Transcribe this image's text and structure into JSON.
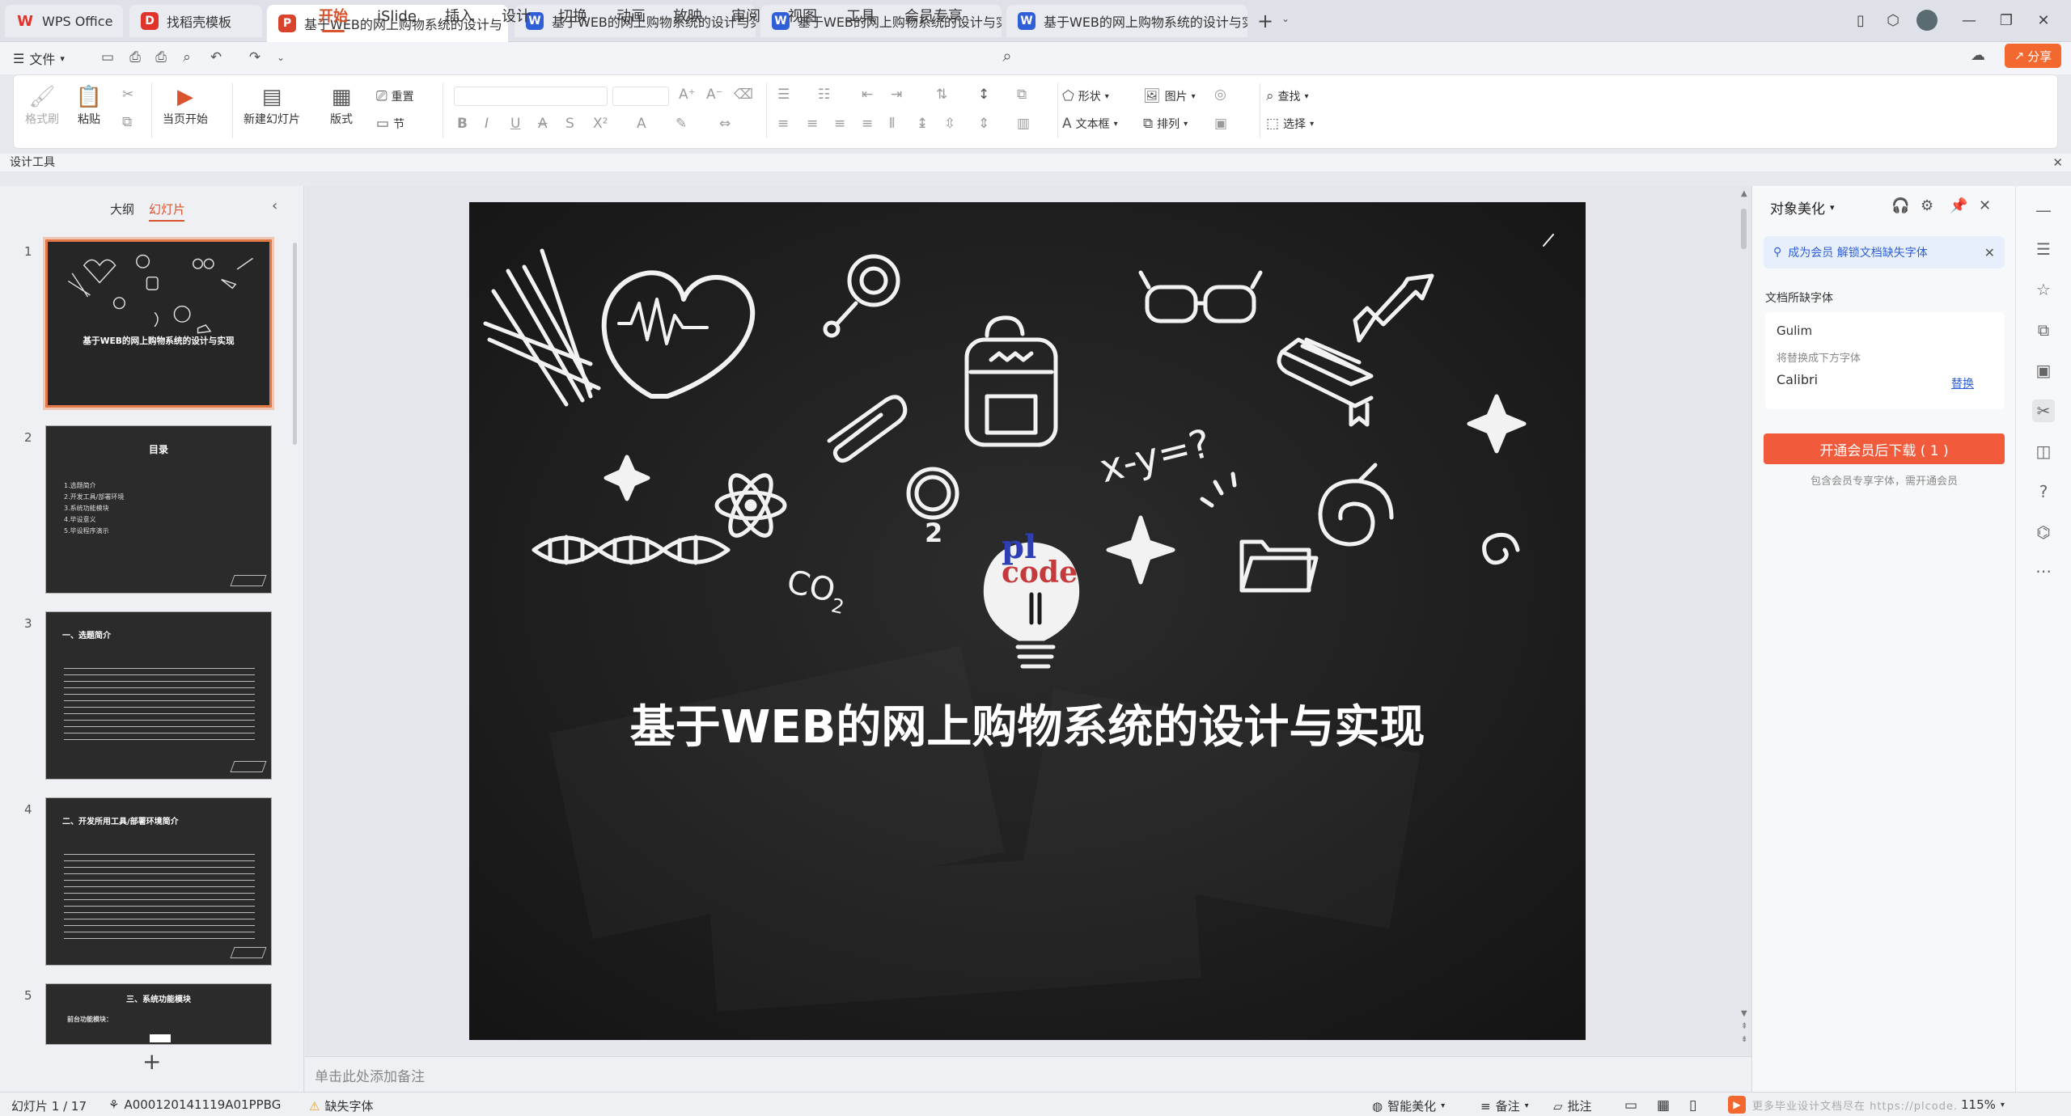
{
  "titlebar": {
    "tabs": [
      {
        "label": "WPS Office",
        "icon": "wps-logo",
        "color": "#e0342b",
        "state": "inactive"
      },
      {
        "label": "找稻壳模板",
        "icon": "docer-icon",
        "color": "#e0342b",
        "state": "inactive"
      },
      {
        "label": "基于WEB的网上购物系统的设计与",
        "icon": "P",
        "color": "#d9432c",
        "state": "active"
      },
      {
        "label": "基于WEB的网上购物系统的设计与实",
        "icon": "W",
        "color": "#2f5fd6",
        "state": "inactive"
      },
      {
        "label": "基于WEB的网上购物系统的设计与实",
        "icon": "W",
        "color": "#2f5fd6",
        "state": "inactive"
      },
      {
        "label": "基于WEB的网上购物系统的设计与实",
        "icon": "W",
        "color": "#2f5fd6",
        "state": "inactive"
      }
    ],
    "new_tab": "+"
  },
  "menubar": {
    "file": "文件",
    "items": [
      "开始",
      "iSlide",
      "插入",
      "设计",
      "切换",
      "动画",
      "放映",
      "审阅",
      "视图",
      "工具",
      "会员专享"
    ],
    "active": "开始",
    "share": "分享"
  },
  "ribbon": {
    "format_painter": "格式刷",
    "paste": "粘贴",
    "play_from_current": "当页开始",
    "new_slide": "新建幻灯片",
    "layout": "版式",
    "reset": "重置",
    "section": "节",
    "shape": "形状",
    "picture": "图片",
    "textbox": "文本框",
    "arrange": "排列",
    "find": "查找",
    "select": "选择"
  },
  "design_tools": "设计工具",
  "left_panel": {
    "tab_outline": "大纲",
    "tab_slides": "幻灯片",
    "add_button": "+",
    "thumbs": [
      {
        "num": "1",
        "title": "基于WEB的网上购物系统的设计与实现"
      },
      {
        "num": "2",
        "title": "目录",
        "lines": [
          "1.选题简介",
          "2.开发工具/部署环境",
          "3.系统功能模块",
          "4.毕设意义",
          "5.毕设程序演示"
        ]
      },
      {
        "num": "3",
        "title": "一、选题简介"
      },
      {
        "num": "4",
        "title": "二、开发所用工具/部署环境简介"
      },
      {
        "num": "5",
        "title": "三、系统功能模块",
        "sub": "前台功能模块："
      }
    ]
  },
  "slide": {
    "title": "基于WEB的网上购物系统的设计与实现",
    "doodle_math": "x-y=?",
    "doodle_co2": "CO",
    "doodle_co2_sub": "2",
    "doodle_two": "2",
    "watermark_top": "pl",
    "watermark_bottom": "code"
  },
  "notes_placeholder": "单击此处添加备注",
  "right_panel": {
    "title": "对象美化",
    "member_tip": "成为会员 解锁文档缺失字体",
    "missing_fonts_label": "文档所缺字体",
    "missing_font": "Gulim",
    "replace_with_label": "将替换成下方字体",
    "replacement_font": "Calibri",
    "replace_link": "替换",
    "download_button": "开通会员后下载 ( 1 )",
    "download_note": "包含会员专享字体，需开通会员",
    "accent": "#f15a3a"
  },
  "statusbar": {
    "slide_counter": "幻灯片 1 / 17",
    "template_id": "A000120141119A01PPBG",
    "missing_font": "缺失字体",
    "smart_beautify": "智能美化",
    "notes": "备注",
    "comments": "批注",
    "zoom": "115%",
    "watermark_text": "更多毕业设计文档尽在 https://plcode.cn"
  }
}
